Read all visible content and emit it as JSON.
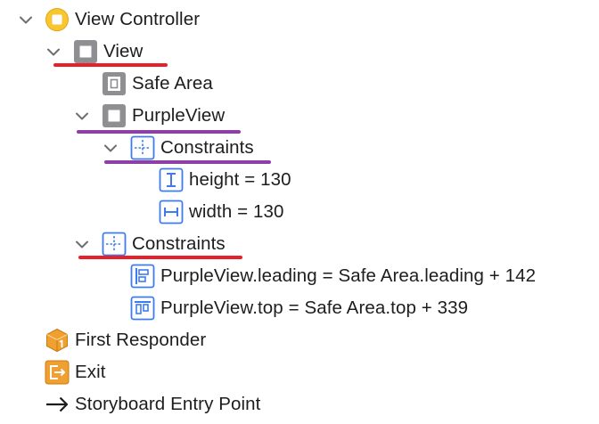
{
  "outline": {
    "view_controller": {
      "label": "View Controller",
      "icon": "view-controller-icon",
      "expanded": true
    },
    "view": {
      "label": "View",
      "icon": "view-icon",
      "expanded": true
    },
    "safe_area": {
      "label": "Safe Area",
      "icon": "safe-area-icon"
    },
    "purple_view": {
      "label": "PurpleView",
      "icon": "view-icon",
      "expanded": true
    },
    "purple_constraints": {
      "label": "Constraints",
      "icon": "constraints-icon",
      "expanded": true
    },
    "height_constraint": {
      "label": "height = 130",
      "icon": "height-constraint-icon"
    },
    "width_constraint": {
      "label": "width = 130",
      "icon": "width-constraint-icon"
    },
    "view_constraints": {
      "label": "Constraints",
      "icon": "constraints-icon",
      "expanded": true
    },
    "leading_constraint": {
      "label": "PurpleView.leading = Safe Area.leading + 142",
      "icon": "leading-constraint-icon"
    },
    "top_constraint": {
      "label": "PurpleView.top = Safe Area.top + 339",
      "icon": "top-constraint-icon"
    },
    "first_responder": {
      "label": "First Responder",
      "icon": "first-responder-icon"
    },
    "exit": {
      "label": "Exit",
      "icon": "exit-icon"
    },
    "entry_point": {
      "label": "Storyboard Entry Point",
      "icon": "arrow-right-icon"
    }
  },
  "colors": {
    "annotation_red": "#e8202a",
    "annotation_purple": "#8e3fa6",
    "constraint_blue": "#3d7cf0",
    "view_gray": "#8e8e93",
    "controller_yellow": "#f7c631",
    "responder_orange": "#f0a030"
  }
}
